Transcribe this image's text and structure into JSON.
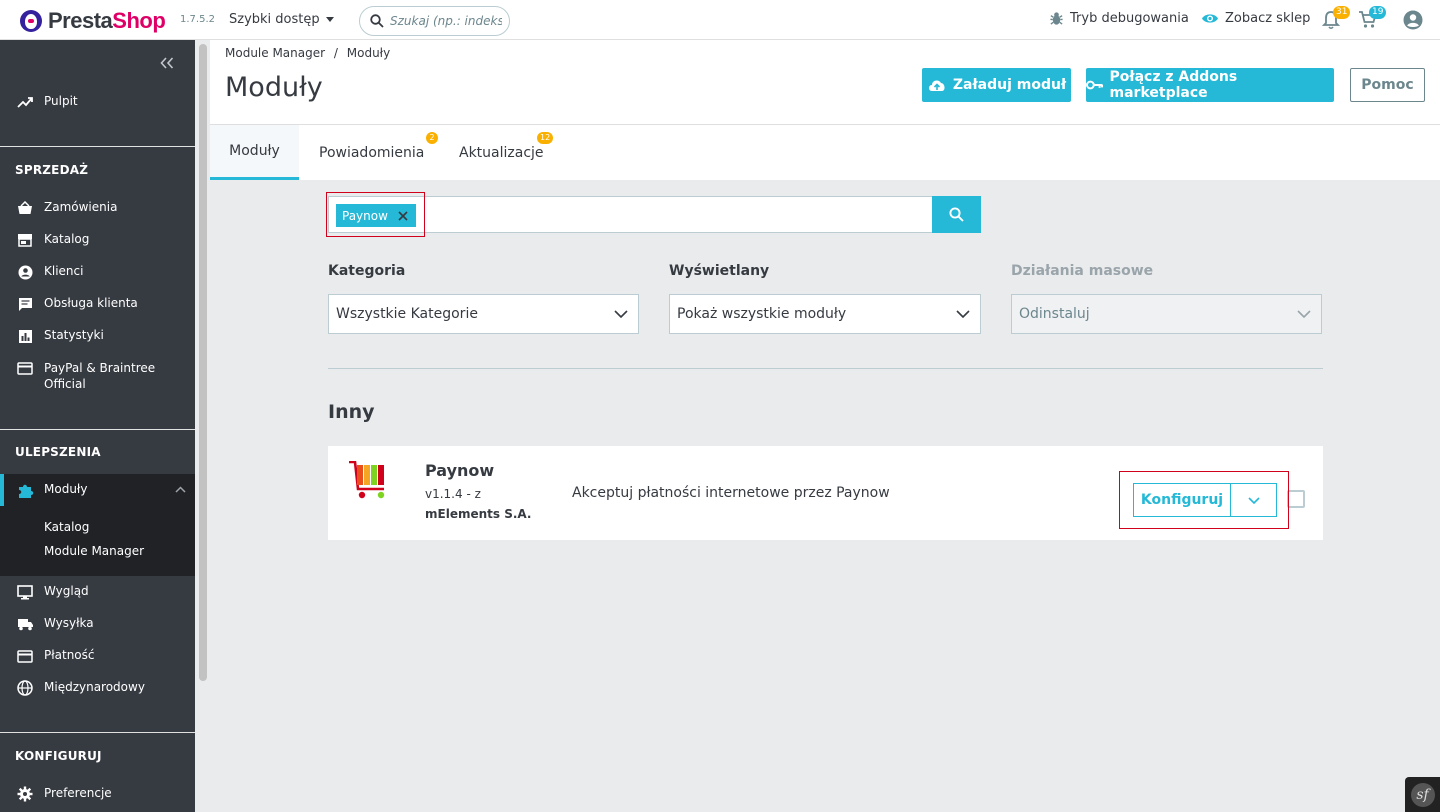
{
  "header": {
    "logo_presta": "Presta",
    "logo_shop": "Shop",
    "version": "1.7.5.2",
    "quick_access": "Szybki dostęp",
    "search_placeholder": "Szukaj (np.: indeks pr",
    "debug_label": "Tryb debugowania",
    "view_shop_label": "Zobacz sklep",
    "notifications_count": "31",
    "orders_count": "19"
  },
  "sidebar": {
    "dashboard": "Pulpit",
    "sell_heading": "SPRZEDAŻ",
    "sell_items": [
      "Zamówienia",
      "Katalog",
      "Klienci",
      "Obsługa klienta",
      "Statystyki"
    ],
    "paypal_line1": "PayPal & Braintree",
    "paypal_line2": "Official",
    "improve_heading": "ULEPSZENIA",
    "modules": "Moduły",
    "modules_sub": [
      "Katalog",
      "Module Manager"
    ],
    "improve_items": [
      "Wygląd",
      "Wysyłka",
      "Płatność",
      "Międzynarodowy"
    ],
    "configure_heading": "KONFIGURUJ",
    "preferences": "Preferencje"
  },
  "page": {
    "breadcrumb_parent": "Module Manager",
    "breadcrumb_sep": "/",
    "breadcrumb_current": "Moduły",
    "title": "Moduły",
    "upload_button": "Załaduj moduł",
    "connect_button": "Połącz z Addons marketplace",
    "help_button": "Pomoc"
  },
  "tabs": [
    {
      "label": "Moduły",
      "badge": ""
    },
    {
      "label": "Powiadomienia",
      "badge": "2"
    },
    {
      "label": "Aktualizacje",
      "badge": "12"
    }
  ],
  "search": {
    "tag": "Paynow"
  },
  "filters": {
    "category_label": "Kategoria",
    "category_value": "Wszystkie Kategorie",
    "display_label": "Wyświetlany",
    "display_value": "Pokaż wszystkie moduły",
    "bulk_label": "Działania masowe",
    "bulk_value": "Odinstaluj"
  },
  "section_title": "Inny",
  "module": {
    "name": "Paynow",
    "version": "v1.1.4 - z",
    "author": "mElements S.A.",
    "description": "Akceptuj płatności internetowe przez Paynow",
    "configure_button": "Konfiguruj"
  },
  "colors": {
    "accent": "#25b9d7",
    "sidebar": "#363a41",
    "highlight": "#d0021b",
    "badge_orange": "#fab000"
  }
}
